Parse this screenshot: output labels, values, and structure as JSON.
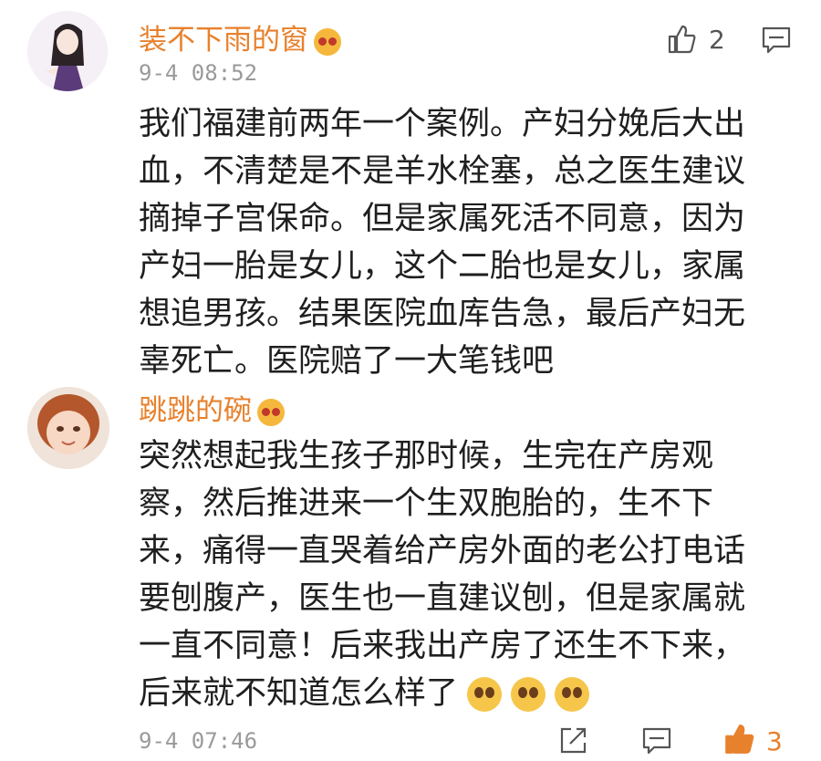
{
  "comments": [
    {
      "username": "装不下雨的窗",
      "time": "9-4 08:52",
      "likes": "2",
      "lines": [
        "我们福建前两年一个案例。产妇分娩后大出",
        "血，不清楚是不是羊水栓塞，总之医生建议",
        "摘掉子宫保命。但是家属死活不同意，因为",
        "产妇一胎是女儿，这个二胎也是女儿，家属",
        "想追男孩。结果医院血库告急，最后产妇无",
        "辜死亡。医院赔了一大笔钱吧"
      ]
    },
    {
      "username": "跳跳的碗",
      "time": "9-4 07:46",
      "likes": "3",
      "lines": [
        "突然想起我生孩子那时候，生完在产房观",
        "察，然后推进来一个生双胞胎的，生不下",
        "来，痛得一直哭着给产房外面的老公打电话",
        "要刨腹产，医生也一直建议刨，但是家属就",
        "一直不同意！后来我出产房了还生不下来，",
        "后来就不知道怎么样了"
      ]
    }
  ],
  "colors": {
    "username": "#e8812c",
    "time": "#9a9a9a",
    "text": "#1f1f1f",
    "liked": "#e8812c"
  },
  "icons": [
    "thumbs-up-icon",
    "comment-icon",
    "share-icon",
    "vip-badge-icon",
    "pleading-face-emoji"
  ]
}
